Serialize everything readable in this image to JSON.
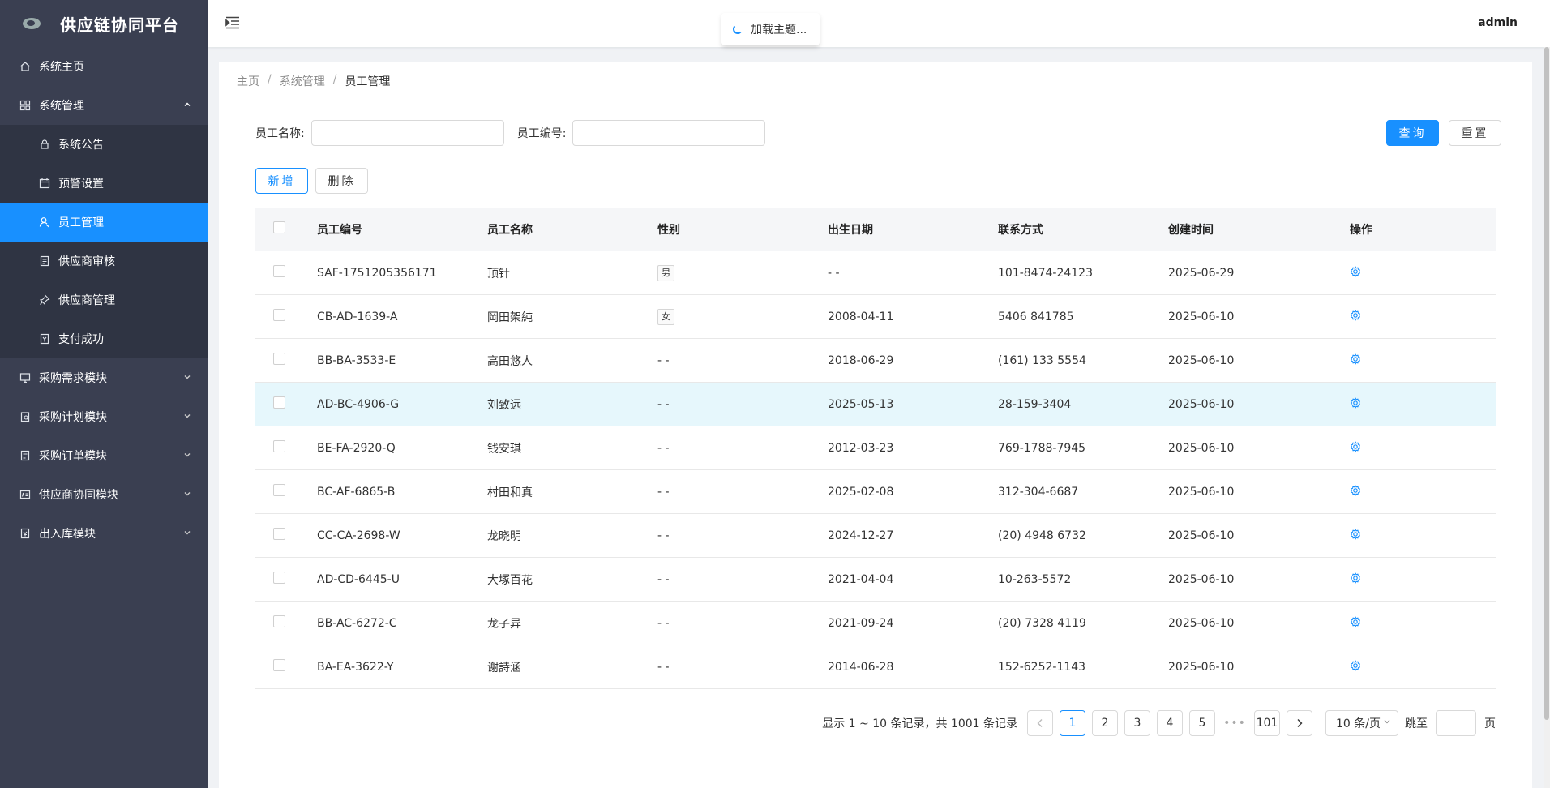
{
  "app": {
    "title": "供应链协同平台"
  },
  "header": {
    "toast": "加载主题...",
    "user": "admin"
  },
  "sidebar": {
    "items": [
      {
        "label": "系统主页",
        "icon": "home-icon"
      },
      {
        "label": "系统管理",
        "icon": "grid-icon",
        "expanded": true,
        "children": [
          {
            "label": "系统公告",
            "icon": "lock-icon"
          },
          {
            "label": "预警设置",
            "icon": "calendar-icon"
          },
          {
            "label": "员工管理",
            "icon": "user-icon",
            "active": true
          },
          {
            "label": "供应商审核",
            "icon": "document-icon"
          },
          {
            "label": "供应商管理",
            "icon": "pin-icon"
          },
          {
            "label": "支付成功",
            "icon": "receipt-icon"
          }
        ]
      },
      {
        "label": "采购需求模块",
        "icon": "monitor-icon"
      },
      {
        "label": "采购计划模块",
        "icon": "clipboard-icon"
      },
      {
        "label": "采购订单模块",
        "icon": "document-icon"
      },
      {
        "label": "供应商协同模块",
        "icon": "card-icon"
      },
      {
        "label": "出入库模块",
        "icon": "receipt-icon"
      }
    ]
  },
  "breadcrumb": [
    "主页",
    "系统管理",
    "员工管理"
  ],
  "search": {
    "name_label": "员工名称:",
    "id_label": "员工编号:",
    "name_value": "",
    "id_value": "",
    "query_label": "查询",
    "reset_label": "重置"
  },
  "actions": {
    "add_label": "新增",
    "delete_label": "删除"
  },
  "table": {
    "columns": [
      "员工编号",
      "员工名称",
      "性别",
      "出生日期",
      "联系方式",
      "创建时间",
      "操作"
    ],
    "rows": [
      {
        "id": "SAF-1751205356171",
        "name": "顶针",
        "gender": "男",
        "birth": "- -",
        "contact": "101-8474-24123",
        "created": "2025-06-29"
      },
      {
        "id": "CB-AD-1639-A",
        "name": "岡田架純",
        "gender": "女",
        "birth": "2008-04-11",
        "contact": "5406 841785",
        "created": "2025-06-10"
      },
      {
        "id": "BB-BA-3533-E",
        "name": "高田悠人",
        "gender": "- -",
        "birth": "2018-06-29",
        "contact": "(161) 133 5554",
        "created": "2025-06-10"
      },
      {
        "id": "AD-BC-4906-G",
        "name": "刘致远",
        "gender": "- -",
        "birth": "2025-05-13",
        "contact": "28-159-3404",
        "created": "2025-06-10"
      },
      {
        "id": "BE-FA-2920-Q",
        "name": "钱安琪",
        "gender": "- -",
        "birth": "2012-03-23",
        "contact": "769-1788-7945",
        "created": "2025-06-10"
      },
      {
        "id": "BC-AF-6865-B",
        "name": "村田和真",
        "gender": "- -",
        "birth": "2025-02-08",
        "contact": "312-304-6687",
        "created": "2025-06-10"
      },
      {
        "id": "CC-CA-2698-W",
        "name": "龙晓明",
        "gender": "- -",
        "birth": "2024-12-27",
        "contact": "(20) 4948 6732",
        "created": "2025-06-10"
      },
      {
        "id": "AD-CD-6445-U",
        "name": "大塚百花",
        "gender": "- -",
        "birth": "2021-04-04",
        "contact": "10-263-5572",
        "created": "2025-06-10"
      },
      {
        "id": "BB-AC-6272-C",
        "name": "龙子异",
        "gender": "- -",
        "birth": "2021-09-24",
        "contact": "(20) 7328 4119",
        "created": "2025-06-10"
      },
      {
        "id": "BA-EA-3622-Y",
        "name": "谢詩涵",
        "gender": "- -",
        "birth": "2014-06-28",
        "contact": "152-6252-1143",
        "created": "2025-06-10"
      }
    ]
  },
  "pagination": {
    "summary": "显示 1 ~ 10 条记录，共 1001 条记录",
    "pages": [
      "1",
      "2",
      "3",
      "4",
      "5"
    ],
    "ellipsis": "•••",
    "last": "101",
    "current": "1",
    "page_size": "10 条/页",
    "jump_label": "跳至",
    "jump_suffix": "页",
    "prev_icon": "chevron-left-icon",
    "next_icon": "chevron-right-icon"
  },
  "colors": {
    "primary": "#1890ff",
    "sidebar": "#3a3f51",
    "submenu": "#2f3443",
    "row_hover": "#e6f7fc"
  }
}
